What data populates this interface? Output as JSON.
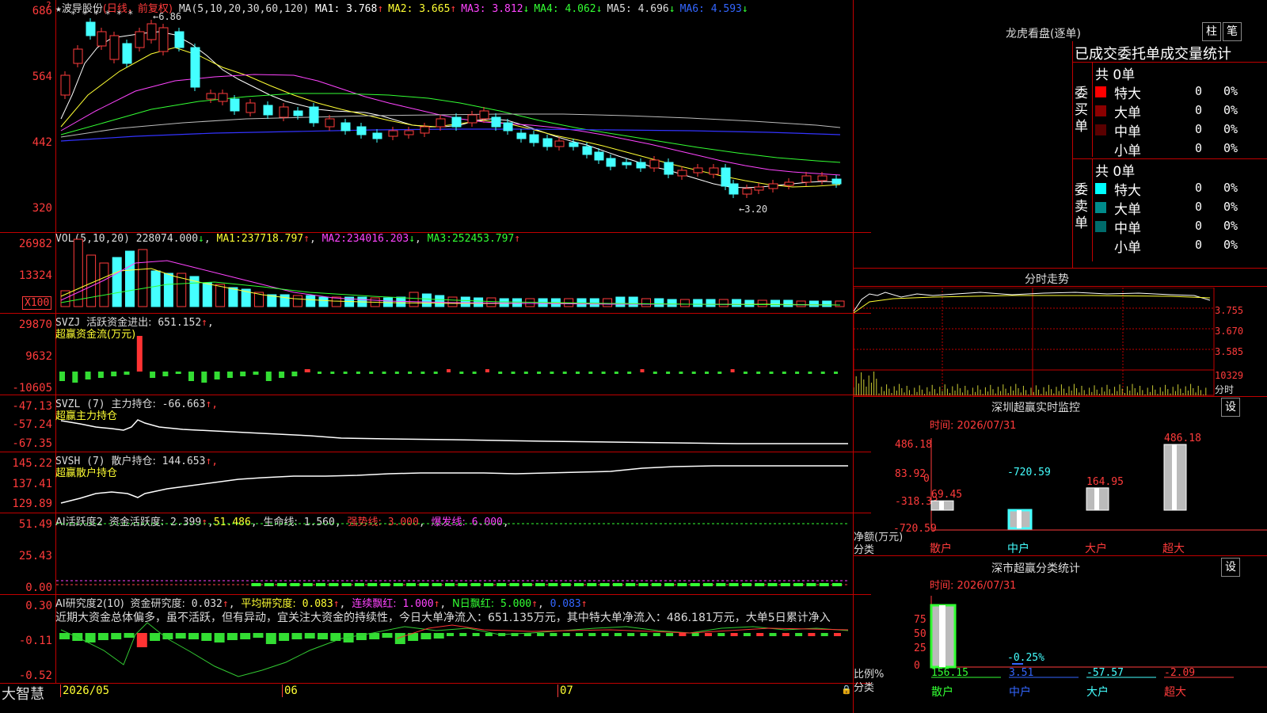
{
  "stock": {
    "star": "★",
    "name": "波导股份",
    "period": "(日线，前复权)",
    "high_marker": "6.86",
    "low_marker": "←3.20",
    "high_marker_prefix": "←"
  },
  "price_axis": [
    "686",
    "564",
    "442",
    "320"
  ],
  "ma_line": {
    "label": "MA(5,10,20,30,60,120)",
    "items": [
      {
        "label": "MA1:",
        "value": "3.768",
        "arrow": "↑",
        "color": "#ffffff"
      },
      {
        "label": "MA2:",
        "value": "3.665",
        "arrow": "↑",
        "color": "#ffff33"
      },
      {
        "label": "MA3:",
        "value": "3.812",
        "arrow": "↓",
        "color": "#ff44ff"
      },
      {
        "label": "MA4:",
        "value": "4.062",
        "arrow": "↓",
        "color": "#33ff33"
      },
      {
        "label": "MA5:",
        "value": "4.696",
        "arrow": "↓",
        "color": "#dddddd"
      },
      {
        "label": "MA6:",
        "value": "4.593",
        "arrow": "↓",
        "color": "#3366ff"
      }
    ]
  },
  "vol": {
    "label": "VOL(5,10,20)",
    "value": "228074.000",
    "arrow": "↓",
    "ma1_label": "MA1:",
    "ma1": "237718.797",
    "ma1_arrow": "↑",
    "ma2_label": "MA2:",
    "ma2": "234016.203",
    "ma2_arrow": "↓",
    "ma3_label": "MA3:",
    "ma3": "252453.797",
    "ma3_arrow": "↑",
    "axis": [
      "26982",
      "13324"
    ],
    "unit": "X100"
  },
  "svzj": {
    "label": "SVZJ",
    "title": "活跃资金进出:",
    "value": "651.152",
    "arrow": "↑",
    "subtitle": "超赢资金流(万元)",
    "axis": [
      "29870",
      "9632",
      "-10605"
    ]
  },
  "svzl": {
    "label": "SVZL (7)",
    "title": "主力持仓:",
    "value": "-66.663",
    "arrow": "↑,",
    "subtitle": "超赢主力持仓",
    "axis": [
      "-47.13",
      "-57.24",
      "-67.35"
    ]
  },
  "svsh": {
    "label": "SVSH (7)",
    "title": "散户持仓:",
    "value": "144.653",
    "arrow": "↑,",
    "subtitle": "超赢散户持仓",
    "axis": [
      "145.22",
      "137.41",
      "129.89"
    ]
  },
  "ai_active": {
    "label": "AI活跃度2",
    "title": "资金活跃度:",
    "value": "2.399",
    "arrow": "↑",
    "v2": "51.486",
    "life_label": "生命线:",
    "life": "1.560",
    "strong_label": "强势线:",
    "strong": "3.000",
    "burst_label": "爆发线:",
    "burst": "6.000",
    "axis": [
      "51.49",
      "25.43",
      "0.00"
    ]
  },
  "ai_research": {
    "label": "AI研究度2(10)",
    "title": "资金研究度:",
    "value": "0.032",
    "avg_label": "平均研究度:",
    "avg": "0.083",
    "cont_label": "连续飘红:",
    "cont": "1.000",
    "n_label": "N日飘红:",
    "n": "5.000",
    "last": "0.083",
    "axis": [
      "0.30",
      "-0.11",
      "-0.52"
    ],
    "comment": "近期大资金总体偏多，虽不活跃，但有异动，宜关注大资金的持续性，今日大单净流入：651.135万元，其中特大单净流入：486.181万元，大单5日累计净入"
  },
  "bottom": {
    "logo": "大智慧",
    "dates": [
      "2026/05",
      "06",
      "07"
    ]
  },
  "longhu": {
    "title": "龙虎看盘(逐单)",
    "btn1": "柱",
    "btn2": "笔",
    "header": "已成交委托单成交量统计",
    "buy_label": "委买单",
    "sell_label": "委卖单",
    "buy": {
      "total": "共 0单",
      "rows": [
        {
          "name": "特大",
          "count": "0",
          "pct": "0%",
          "color": "#ff0000"
        },
        {
          "name": "大单",
          "count": "0",
          "pct": "0%",
          "color": "#8b0000"
        },
        {
          "name": "中单",
          "count": "0",
          "pct": "0%",
          "color": "#5a0000"
        },
        {
          "name": "小单",
          "count": "0",
          "pct": "0%",
          "color": ""
        }
      ]
    },
    "sell": {
      "total": "共 0单",
      "rows": [
        {
          "name": "特大",
          "count": "0",
          "pct": "0%",
          "color": "#00ffff"
        },
        {
          "name": "大单",
          "count": "0",
          "pct": "0%",
          "color": "#008b8b"
        },
        {
          "name": "中单",
          "count": "0",
          "pct": "0%",
          "color": "#006b6b"
        },
        {
          "name": "小单",
          "count": "0",
          "pct": "0%",
          "color": ""
        }
      ]
    }
  },
  "intraday": {
    "title": "分时走势",
    "axis": [
      "3.755",
      "3.670",
      "3.585"
    ],
    "vol": "10329",
    "unit": "分时"
  },
  "monitor": {
    "title": "深圳超赢实时监控",
    "btn": "设",
    "time": "时间: 2026/07/31",
    "axis": [
      "486.18",
      "83.92",
      "0",
      "-318.33",
      "-720.59"
    ],
    "ylabel": "净额(万元)",
    "xlabel": "分类",
    "cats": [
      "散户",
      "中户",
      "大户",
      "超大"
    ],
    "bars": [
      {
        "label": "69.45",
        "value": 69.45
      },
      {
        "label": "-720.59",
        "value": -720.59
      },
      {
        "label": "164.95",
        "value": 164.95
      },
      {
        "label": "486.18",
        "value": 486.18
      }
    ]
  },
  "classify": {
    "title": "深市超赢分类统计",
    "btn": "设",
    "time": "时间: 2026/07/31",
    "axis": [
      "75",
      "50",
      "25",
      "0"
    ],
    "ylabel": "比例%",
    "xlabel": "分类",
    "cats": [
      "散户",
      "中户",
      "大户",
      "超大"
    ],
    "vals": [
      "156.15",
      "3.51",
      "-57.57",
      "-2.09"
    ],
    "bar_label": "-0.25%"
  }
}
